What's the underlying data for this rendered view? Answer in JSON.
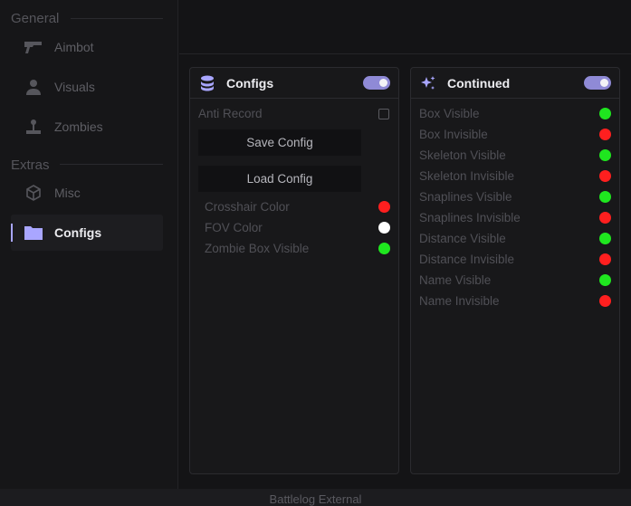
{
  "sidebar": {
    "sections": [
      {
        "title": "General"
      },
      {
        "title": "Extras"
      }
    ],
    "items": [
      {
        "label": "Aimbot",
        "icon": "pistol-icon"
      },
      {
        "label": "Visuals",
        "icon": "user-icon"
      },
      {
        "label": "Zombies",
        "icon": "joystick-icon"
      },
      {
        "label": "Misc",
        "icon": "cube-icon"
      },
      {
        "label": "Configs",
        "icon": "folder-icon",
        "active": true
      }
    ]
  },
  "configs_panel": {
    "title": "Configs",
    "icon": "database-icon",
    "toggle_on": true,
    "anti_record_label": "Anti Record",
    "anti_record_checked": false,
    "save_label": "Save Config",
    "load_label": "Load Config",
    "colors": [
      {
        "label": "Crosshair Color",
        "color": "#ff1f1f"
      },
      {
        "label": "FOV Color",
        "color": "#ffffff"
      },
      {
        "label": "Zombie Box Visible",
        "color": "#1fe61f"
      }
    ]
  },
  "continued_panel": {
    "title": "Continued",
    "icon": "sparkles-icon",
    "toggle_on": true,
    "colors": [
      {
        "label": "Box Visible",
        "color": "#1fe61f"
      },
      {
        "label": "Box Invisible",
        "color": "#ff1f1f"
      },
      {
        "label": "Skeleton Visible",
        "color": "#1fe61f"
      },
      {
        "label": "Skeleton Invisible",
        "color": "#ff1f1f"
      },
      {
        "label": "Snaplines Visible",
        "color": "#1fe61f"
      },
      {
        "label": "Snaplines Invisible",
        "color": "#ff1f1f"
      },
      {
        "label": "Distance Visible",
        "color": "#1fe61f"
      },
      {
        "label": "Distance Invisible",
        "color": "#ff1f1f"
      },
      {
        "label": "Name Visible",
        "color": "#1fe61f"
      },
      {
        "label": "Name Invisible",
        "color": "#ff1f1f"
      }
    ]
  },
  "theme": {
    "accent": "#a9a6ff",
    "toggle": "#8f8ad6"
  },
  "footer": {
    "title": "Battlelog External"
  }
}
